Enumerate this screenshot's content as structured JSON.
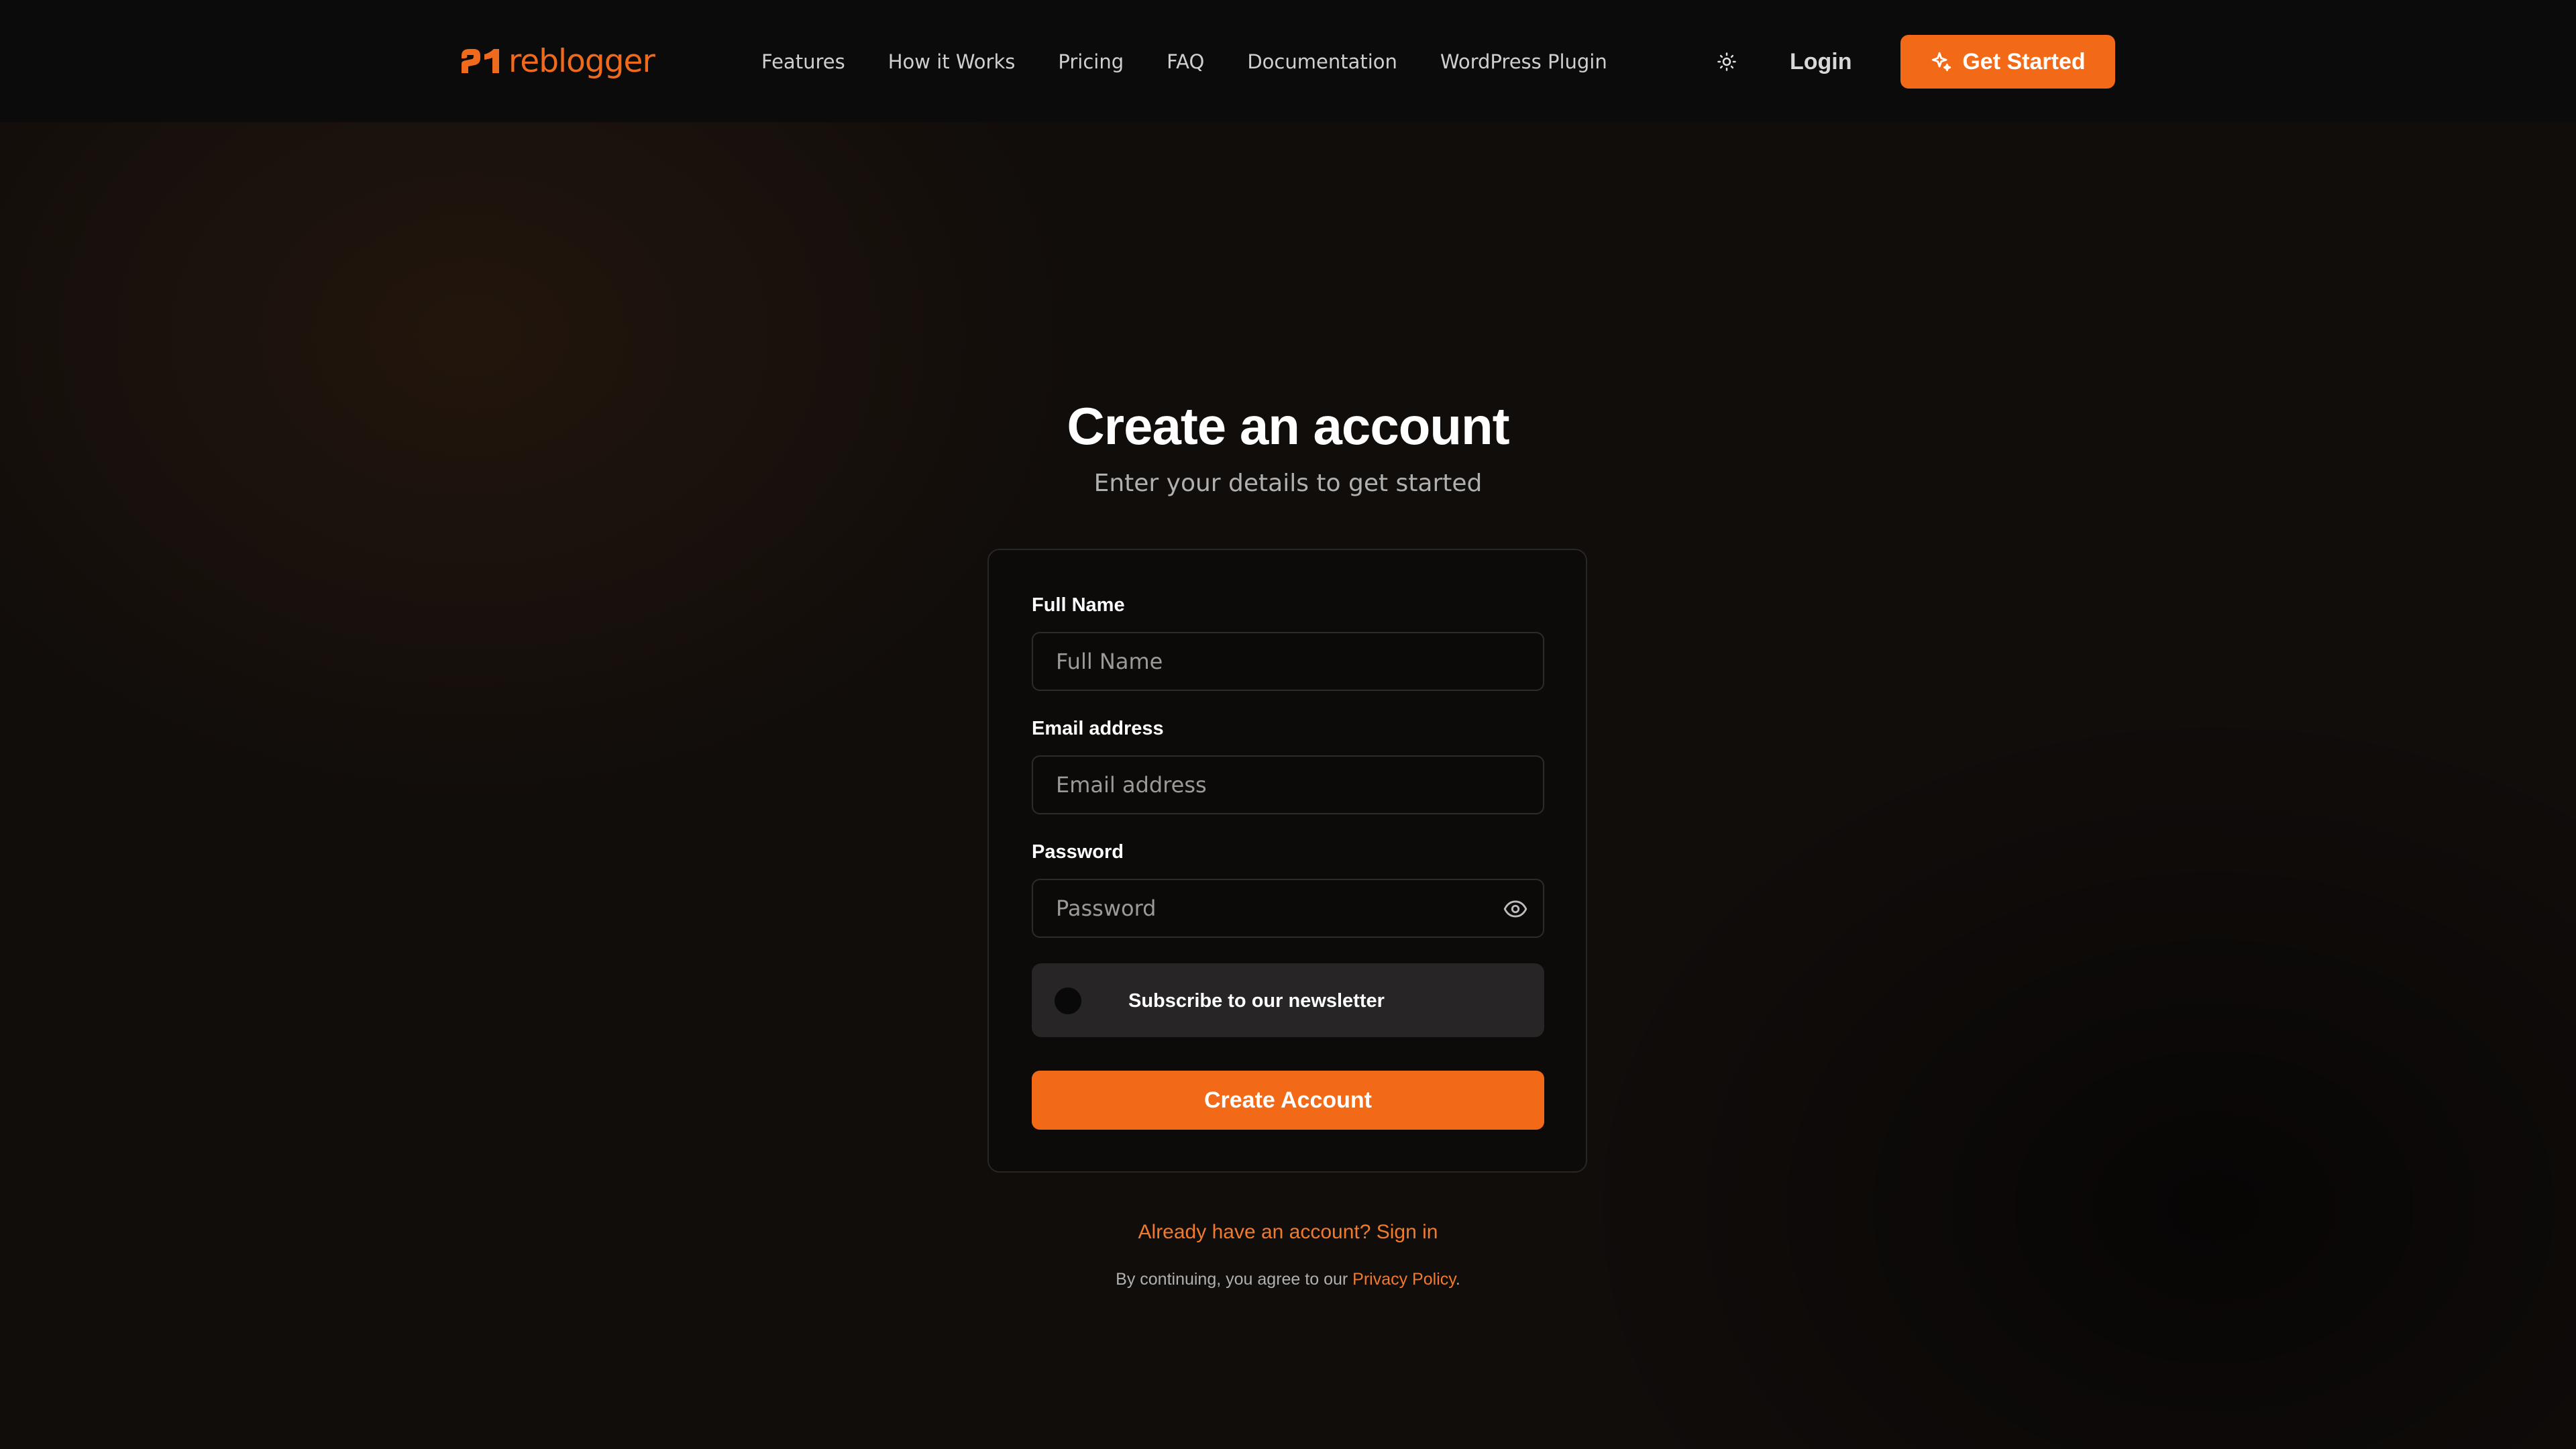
{
  "header": {
    "logo_text": "reblogger",
    "nav": [
      {
        "label": "Features"
      },
      {
        "label": "How it Works"
      },
      {
        "label": "Pricing"
      },
      {
        "label": "FAQ"
      },
      {
        "label": "Documentation"
      },
      {
        "label": "WordPress Plugin"
      }
    ],
    "theme_icon": "sun-icon",
    "login_label": "Login",
    "cta_label": "Get Started",
    "cta_icon": "sparkle-icon"
  },
  "main": {
    "title": "Create an account",
    "subtitle": "Enter your details to get started"
  },
  "form": {
    "full_name": {
      "label": "Full Name",
      "placeholder": "Full Name",
      "value": ""
    },
    "email": {
      "label": "Email address",
      "placeholder": "Email address",
      "value": ""
    },
    "password": {
      "label": "Password",
      "placeholder": "Password",
      "value": "",
      "toggle_icon": "eye-icon"
    },
    "newsletter": {
      "label": "Subscribe to our newsletter",
      "checked": false
    },
    "submit_label": "Create Account"
  },
  "footer": {
    "signin_text": "Already have an account? Sign in",
    "legal_prefix": "By continuing, you agree to our ",
    "privacy_label": "Privacy Policy",
    "legal_suffix": "."
  },
  "colors": {
    "accent": "#f26a18",
    "background": "#110d0b",
    "header_background": "#0c0b0b",
    "card_border": "#2a2624",
    "newsletter_background": "#272525"
  }
}
